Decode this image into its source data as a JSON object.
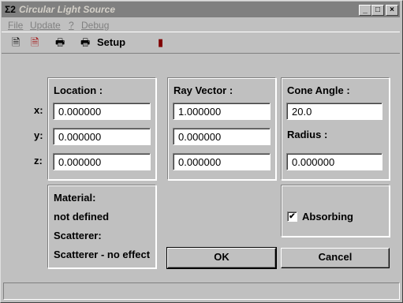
{
  "window": {
    "title": "Circular Light Source",
    "icon_glyph": "Σ2",
    "controls": {
      "minimize": "_",
      "maximize": "□",
      "close": "×"
    }
  },
  "menu": {
    "items": [
      "File",
      "Update",
      "?",
      "Debug"
    ]
  },
  "toolbar": {
    "icons": [
      "new-document-icon",
      "save-document-icon",
      "print-icon",
      "print-setup-icon",
      "exit-door-icon"
    ],
    "icon_glyphs": {
      "new": "🗎",
      "save": "🗎",
      "print": "🖶",
      "setup": "🖶",
      "exit": "▮"
    },
    "setup_label": "Setup"
  },
  "location": {
    "heading": "Location :",
    "axis_labels": [
      "x:",
      "y:",
      "z:"
    ],
    "x": "0.000000",
    "y": "0.000000",
    "z": "0.000000"
  },
  "ray_vector": {
    "heading": "Ray Vector :",
    "x": "1.000000",
    "y": "0.000000",
    "z": "0.000000"
  },
  "cone": {
    "angle_label": "Cone Angle :",
    "angle_value": "20.0",
    "radius_label": "Radius :",
    "radius_value": "0.000000"
  },
  "material": {
    "material_label": "Material:",
    "material_value": "not defined",
    "scatterer_label": "Scatterer:",
    "scatterer_value": "Scatterer - no effect"
  },
  "absorbing": {
    "label": "Absorbing",
    "checked": true,
    "check_glyph": "✔"
  },
  "buttons": {
    "ok": "OK",
    "cancel": "Cancel"
  }
}
